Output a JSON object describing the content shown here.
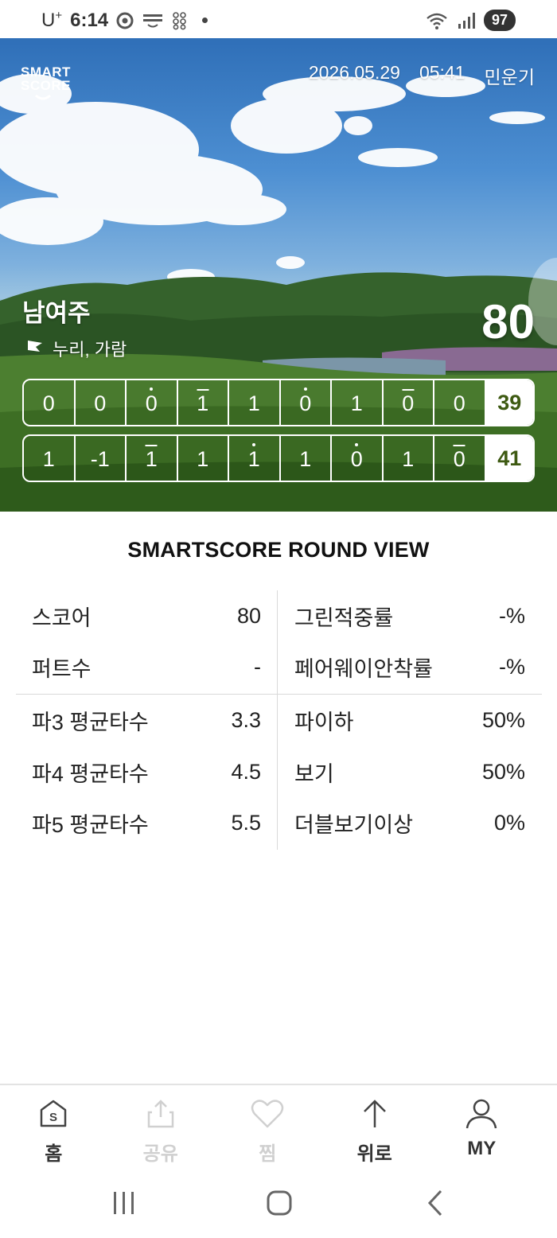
{
  "status_bar": {
    "carrier": "U",
    "carrier_sup": "+",
    "time": "6:14",
    "battery": "97"
  },
  "hero": {
    "logo_line1": "SMART",
    "logo_line2": "SCORE",
    "date": "2026.05.29",
    "tee_time": "05:41",
    "player": "민운기",
    "course": "남여주",
    "sub_courses": "누리, 가람",
    "total": "80",
    "front_nine": {
      "holes": [
        {
          "v": "0",
          "mark": "none"
        },
        {
          "v": "0",
          "mark": "none"
        },
        {
          "v": "0",
          "mark": "dot"
        },
        {
          "v": "1",
          "mark": "bar"
        },
        {
          "v": "1",
          "mark": "none"
        },
        {
          "v": "0",
          "mark": "dot"
        },
        {
          "v": "1",
          "mark": "none"
        },
        {
          "v": "0",
          "mark": "bar"
        },
        {
          "v": "0",
          "mark": "none"
        }
      ],
      "sum": "39"
    },
    "back_nine": {
      "holes": [
        {
          "v": "1",
          "mark": "none"
        },
        {
          "v": "-1",
          "mark": "none"
        },
        {
          "v": "1",
          "mark": "bar"
        },
        {
          "v": "1",
          "mark": "none"
        },
        {
          "v": "1",
          "mark": "dot"
        },
        {
          "v": "1",
          "mark": "none"
        },
        {
          "v": "0",
          "mark": "dot"
        },
        {
          "v": "1",
          "mark": "none"
        },
        {
          "v": "0",
          "mark": "bar"
        }
      ],
      "sum": "41"
    }
  },
  "round_view": {
    "title": "SMARTSCORE ROUND VIEW",
    "left_top": [
      {
        "label": "스코어",
        "value": "80"
      },
      {
        "label": "퍼트수",
        "value": "-"
      }
    ],
    "right_top": [
      {
        "label": "그린적중률",
        "value": "-%"
      },
      {
        "label": "페어웨이안착률",
        "value": "-%"
      }
    ],
    "left_bottom": [
      {
        "label": "파3 평균타수",
        "value": "3.3"
      },
      {
        "label": "파4 평균타수",
        "value": "4.5"
      },
      {
        "label": "파5 평균타수",
        "value": "5.5"
      }
    ],
    "right_bottom": [
      {
        "label": "파이하",
        "value": "50%"
      },
      {
        "label": "보기",
        "value": "50%"
      },
      {
        "label": "더블보기이상",
        "value": "0%"
      }
    ]
  },
  "bottom_nav": {
    "home": "홈",
    "share": "공유",
    "like": "찜",
    "top": "위로",
    "my": "MY"
  },
  "colors": {
    "sum_text": "#3e5a12",
    "disabled": "#d0d0d0"
  }
}
